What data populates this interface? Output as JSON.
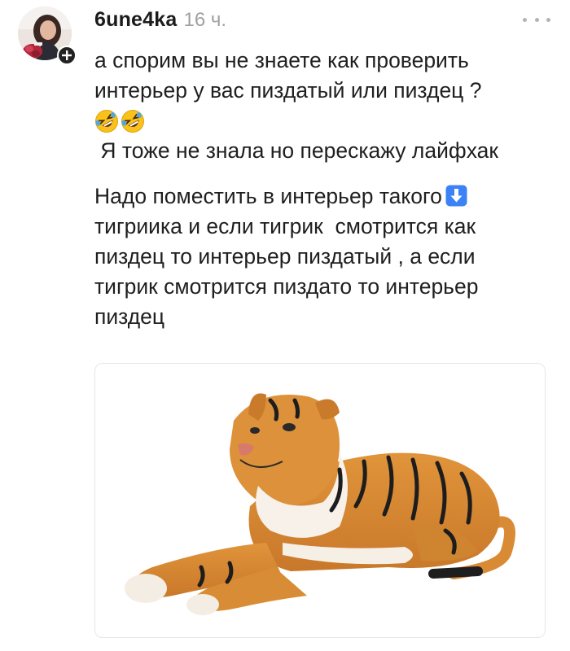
{
  "post": {
    "username": "6une4ka",
    "time": "16 ч.",
    "more_icon": "more-dots-icon",
    "follow_icon": "plus-icon",
    "text_lines_1": [
      "а спорим вы не знаете как проверить",
      "интерьер у вас пиздатый или пиздец ?"
    ],
    "emojis": [
      "rolling-on-floor-laughing-icon",
      "rolling-on-floor-laughing-icon"
    ],
    "text_line_after_emoji": " Я тоже не знала но перескажу лайфхак",
    "text_lines_2": [
      "Надо поместить в интерьер такого",
      "тигриика и если тигрик  смотрится как",
      "пиздец то интерьер пиздатый , а если",
      "тигрик смотрится пиздато то интерьер",
      "пиздец"
    ],
    "arrow_icon": "down-arrow-icon"
  },
  "colors": {
    "text": "#1f1f1f",
    "time": "#a0a0a0",
    "badge": "#222222",
    "arrow_bg": "#3b82f6"
  }
}
